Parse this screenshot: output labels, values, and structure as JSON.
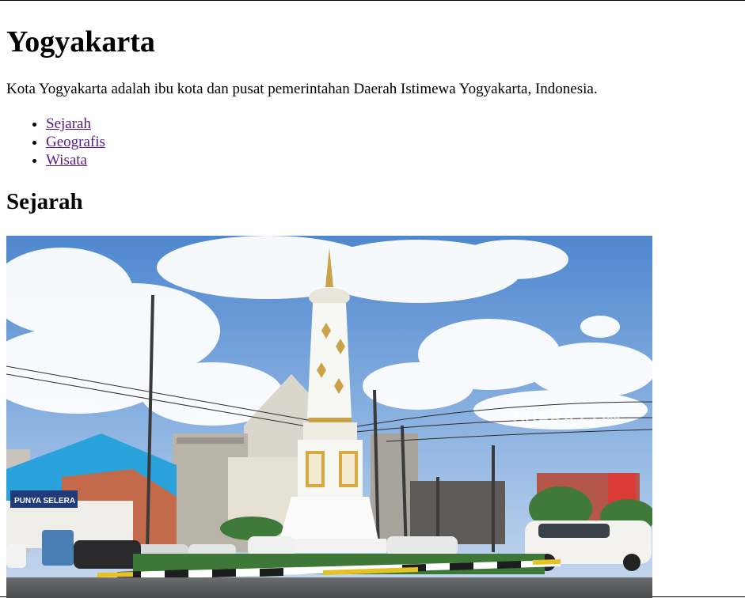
{
  "page": {
    "title": "Yogyakarta",
    "intro": "Kota Yogyakarta adalah ibu kota dan pusat pemerintahan Daerah Istimewa Yogyakarta, Indonesia.",
    "toc": [
      {
        "label": "Sejarah"
      },
      {
        "label": "Geografis"
      },
      {
        "label": "Wisata"
      }
    ],
    "section_title": "Sejarah",
    "image": {
      "alt": "Tugu Yogyakarta",
      "watermark": "SUARA.COM",
      "shop_sign": "PUNYA SELERA"
    }
  },
  "colors": {
    "link": "#551a8b",
    "sky": "#5a8fd3",
    "monument": "#f6f6f6",
    "gold": "#caa040"
  }
}
